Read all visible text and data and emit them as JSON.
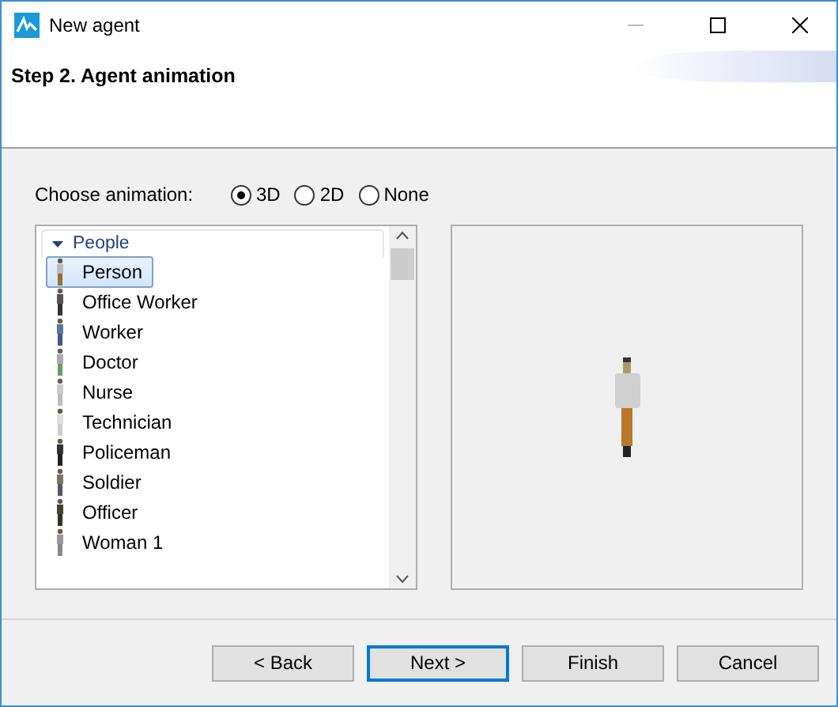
{
  "window": {
    "title": "New agent"
  },
  "header": {
    "title": "Step 2. Agent animation"
  },
  "animation": {
    "label": "Choose animation:",
    "options": [
      {
        "label": "3D",
        "selected": true
      },
      {
        "label": "2D",
        "selected": false
      },
      {
        "label": "None",
        "selected": false
      }
    ]
  },
  "tree": [
    {
      "label": "People",
      "expanded": true,
      "children": [
        {
          "label": "Person",
          "selected": true
        },
        {
          "label": "Office Worker",
          "selected": false
        },
        {
          "label": "Worker",
          "selected": false
        },
        {
          "label": "Doctor",
          "selected": false
        },
        {
          "label": "Nurse",
          "selected": false
        },
        {
          "label": "Technician",
          "selected": false
        },
        {
          "label": "Policeman",
          "selected": false
        },
        {
          "label": "Soldier",
          "selected": false
        },
        {
          "label": "Officer",
          "selected": false
        },
        {
          "label": "Woman 1",
          "selected": false
        }
      ]
    }
  ],
  "buttons": [
    {
      "label": "< Back",
      "default": false
    },
    {
      "label": "Next >",
      "default": true
    },
    {
      "label": "Finish",
      "default": false
    },
    {
      "label": "Cancel",
      "default": false
    }
  ]
}
